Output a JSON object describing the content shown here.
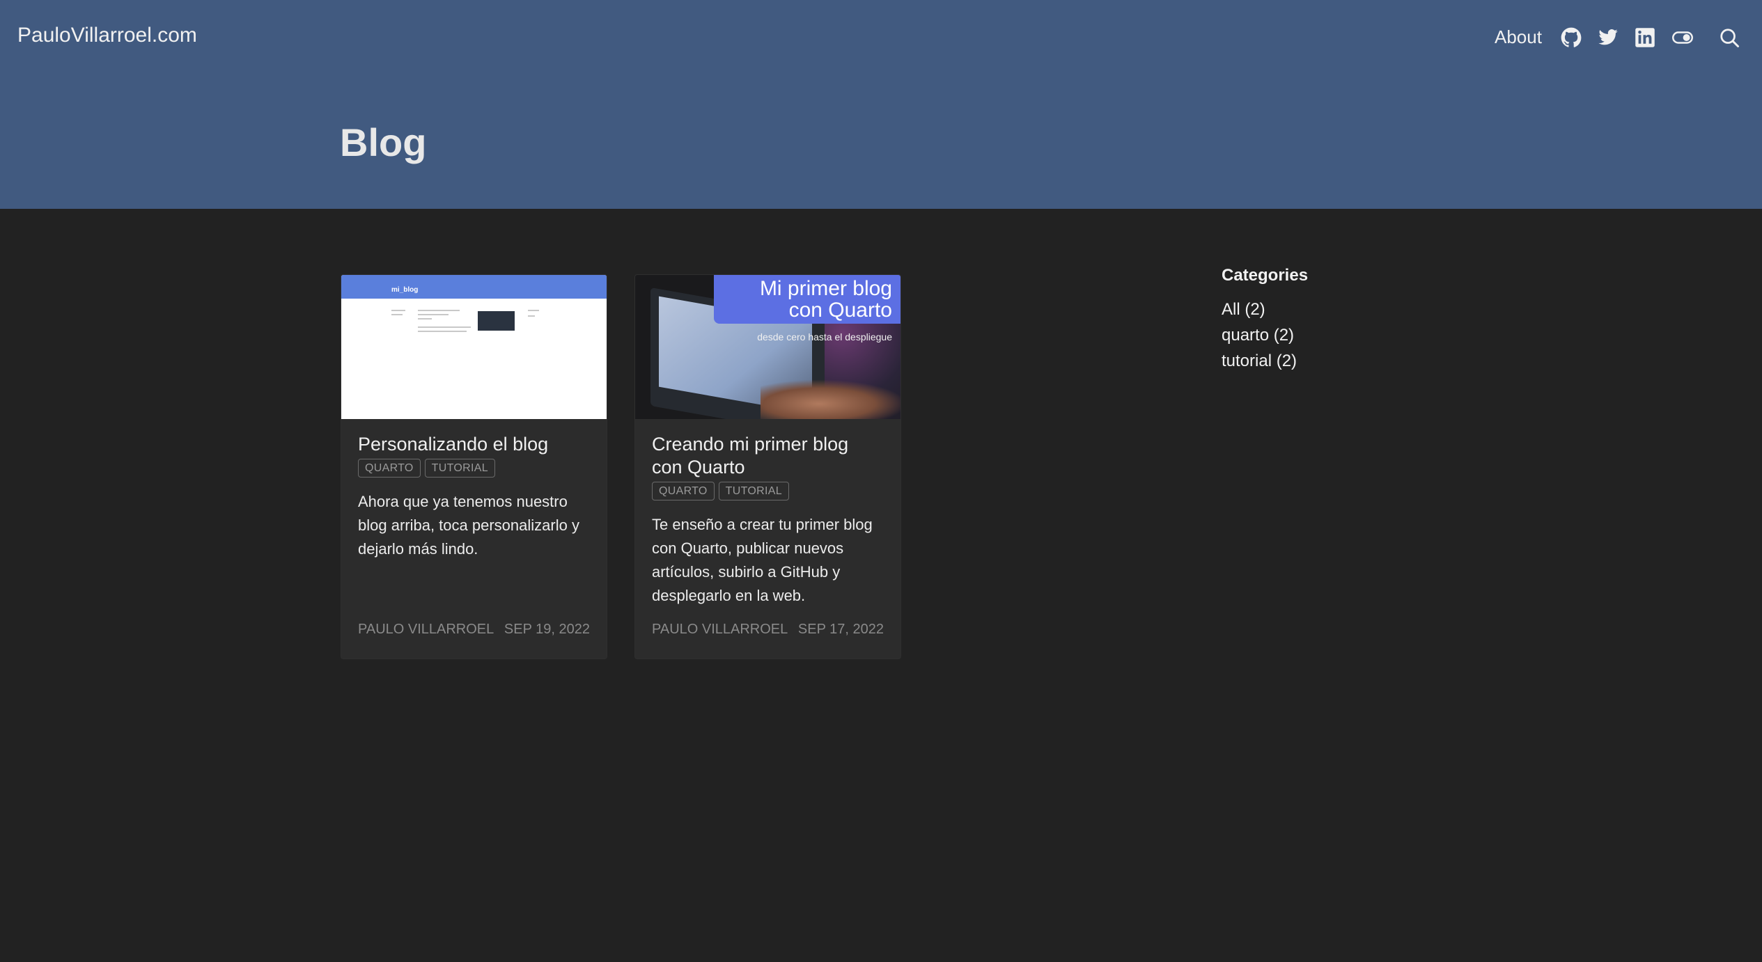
{
  "header": {
    "site_title": "PauloVillarroel.com",
    "nav_about": "About",
    "icons": [
      "github-icon",
      "twitter-icon",
      "linkedin-icon",
      "toggle-theme-icon",
      "search-icon"
    ],
    "background_color": "#415a80"
  },
  "page": {
    "title": "Blog",
    "background_color": "#222222"
  },
  "posts": [
    {
      "title": "Personalizando el blog",
      "tags": [
        "QUARTO",
        "TUTORIAL"
      ],
      "description": "Ahora que ya tenemos nuestro blog arriba, toca personalizarlo y dejarlo más lindo.",
      "author": "PAULO VILLARROEL",
      "date": "SEP 19, 2022",
      "thumbnail": {
        "brand": "mi_blog"
      }
    },
    {
      "title": "Creando mi primer blog con Quarto",
      "tags": [
        "QUARTO",
        "TUTORIAL"
      ],
      "description": "Te enseño a crear tu primer blog con Quarto, publicar nuevos artículos, subirlo a GitHub y desplegarlo en la web.",
      "author": "PAULO VILLARROEL",
      "date": "SEP 17, 2022",
      "thumbnail": {
        "banner_line1": "Mi primer blog",
        "banner_line2": "con Quarto",
        "subtitle": "desde cero hasta el despliegue",
        "banner_color": "#5c6fe3"
      }
    }
  ],
  "sidebar": {
    "title": "Categories",
    "items": [
      "All (2)",
      "quarto (2)",
      "tutorial (2)"
    ]
  }
}
